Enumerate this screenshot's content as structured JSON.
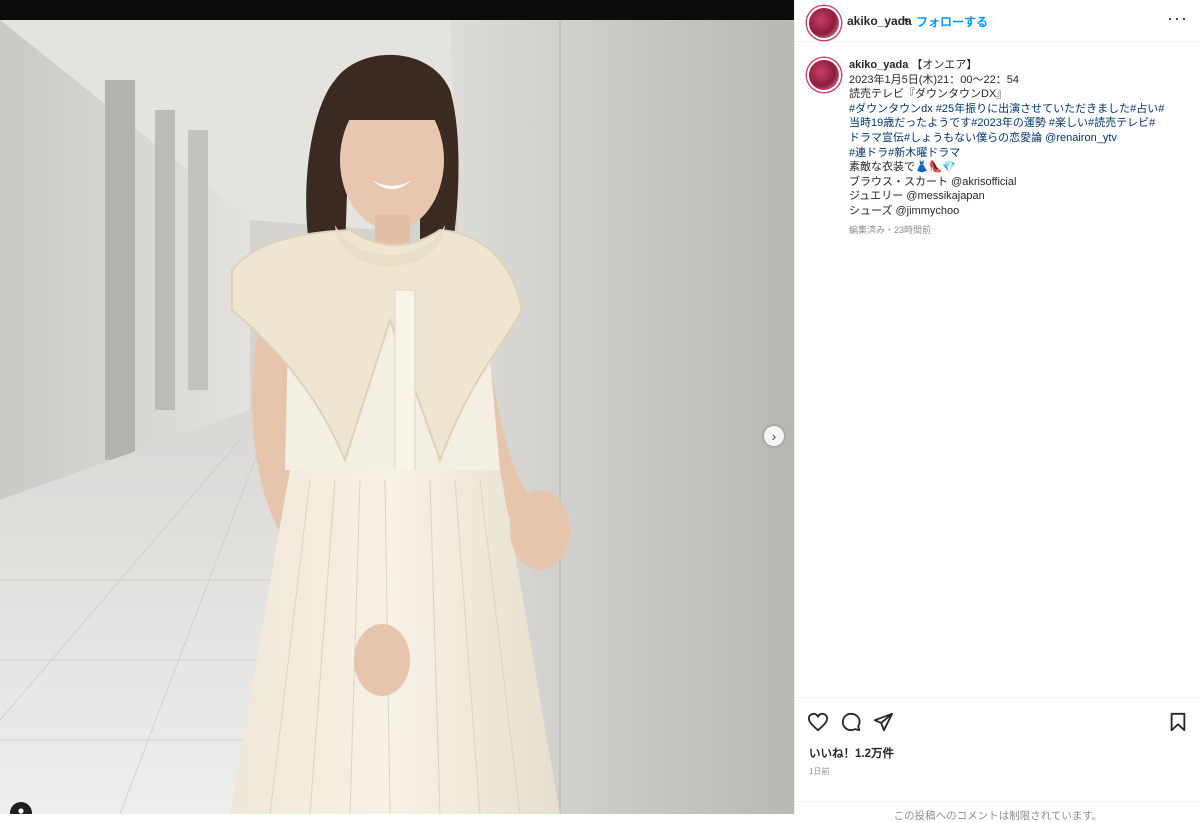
{
  "post": {
    "username": "akiko_yada",
    "separator": "•",
    "follow_label": "フォローする",
    "more_label": "···"
  },
  "caption": {
    "lines": [
      "【オンエア】",
      "2023年1月5日(木)21：00〜22：54",
      "読売テレビ『ダウンタウンDX』",
      "#ダウンタウンdx #25年振りに出演させていただきました#占い#",
      "当時19歳だったようです#2023年の運勢 #楽しい#読売テレビ#",
      "ドラマ宣伝#しょうもない僕らの恋愛論 @renairon_ytv",
      "#連ドラ#新木曜ドラマ",
      "素敵な衣装で👗👠💎",
      "ブラウス・スカート @akrisofficial",
      "ジュエリー @messikajapan",
      "シューズ @jimmychoo"
    ],
    "meta": "編集済み・23時間前"
  },
  "engagement": {
    "likes": "いいね！1.2万件",
    "time": "1日前",
    "comments_disabled": "この投稿へのコメントは制限されています。"
  },
  "media": {
    "carousel_next": "›",
    "carousel_dots": [
      true,
      false,
      false,
      false,
      false,
      false
    ],
    "tag_icon": "person-icon"
  }
}
